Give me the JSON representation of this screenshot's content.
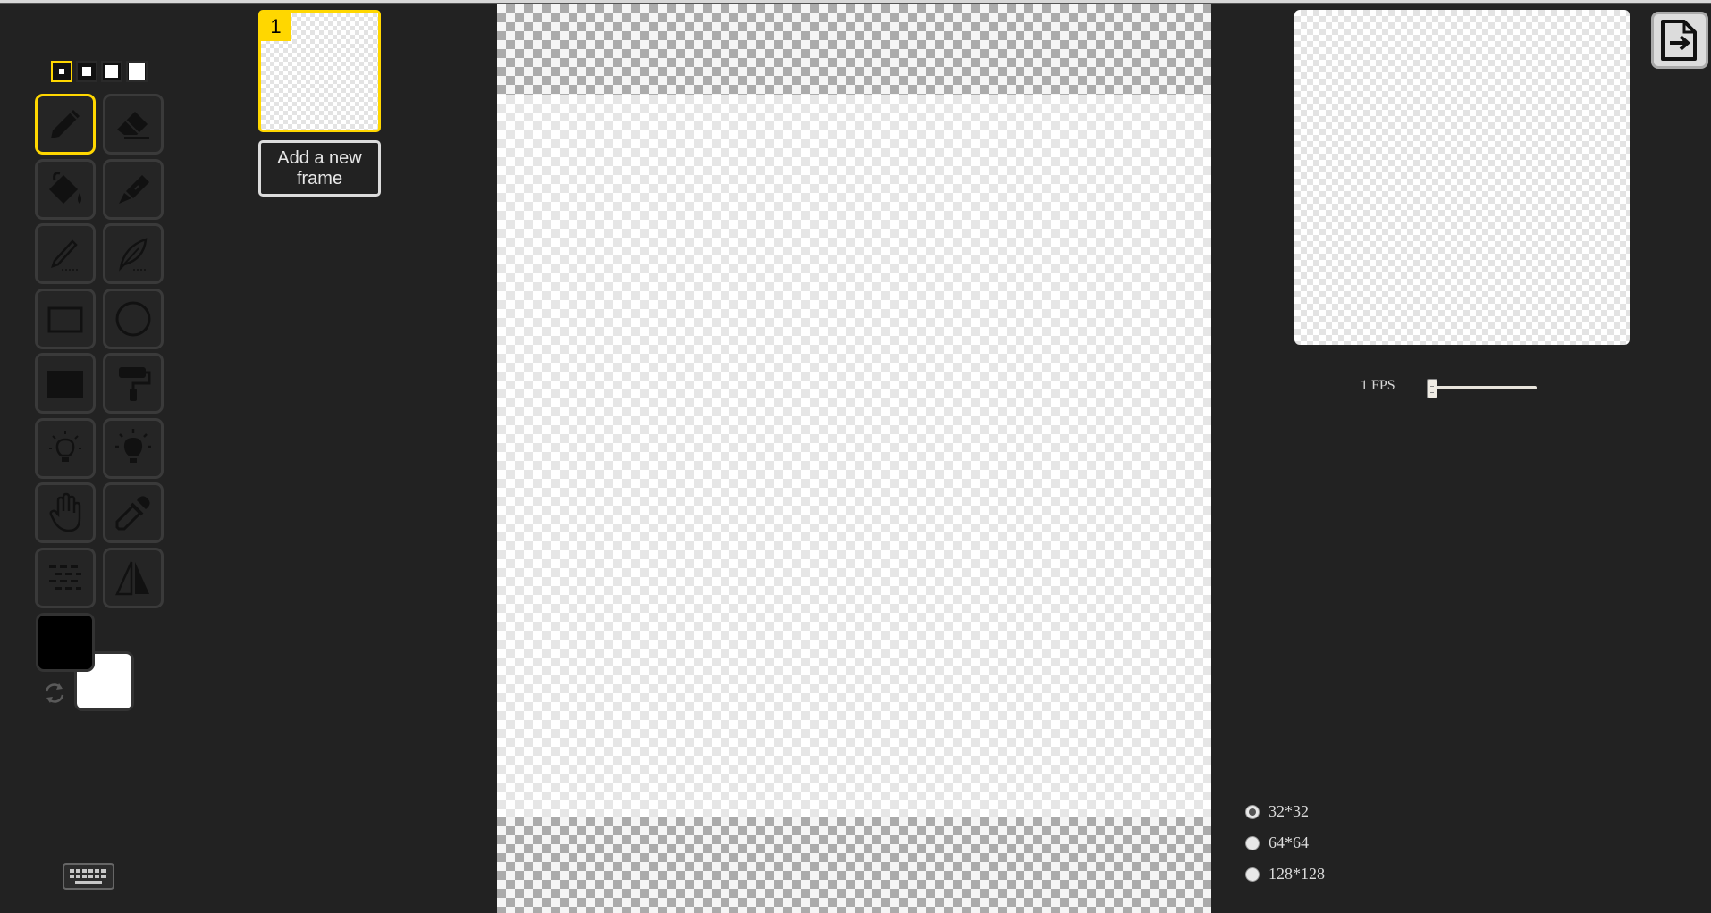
{
  "app": {
    "frames": [
      {
        "number": "1",
        "selected": true
      }
    ],
    "add_frame_label": "Add a new frame"
  },
  "toolbar": {
    "pen_sizes": [
      "pen-size-1",
      "pen-size-2",
      "pen-size-3",
      "pen-size-4"
    ],
    "selected_pen_size": 0,
    "tools": [
      {
        "id": "pen",
        "icon": "pencil-icon",
        "selected": true
      },
      {
        "id": "eraser",
        "icon": "eraser-icon"
      },
      {
        "id": "bucket",
        "icon": "paint-bucket-icon"
      },
      {
        "id": "paint-all",
        "icon": "magic-brush-icon"
      },
      {
        "id": "stroke",
        "icon": "stroke-pencil-icon"
      },
      {
        "id": "vertical-mirror",
        "icon": "feather-icon"
      },
      {
        "id": "rectangle",
        "icon": "rectangle-outline-icon"
      },
      {
        "id": "circle",
        "icon": "circle-outline-icon"
      },
      {
        "id": "filled-rectangle",
        "icon": "filled-rectangle-icon"
      },
      {
        "id": "paint-roller",
        "icon": "paint-roller-icon"
      },
      {
        "id": "lighten",
        "icon": "bulb-outline-icon"
      },
      {
        "id": "darken",
        "icon": "bulb-filled-icon"
      },
      {
        "id": "move",
        "icon": "hand-icon"
      },
      {
        "id": "color-picker",
        "icon": "eyedropper-icon"
      },
      {
        "id": "dithering",
        "icon": "dithering-icon"
      },
      {
        "id": "mirror",
        "icon": "mirror-icon"
      }
    ],
    "primary_color": "#000000",
    "secondary_color": "#ffffff"
  },
  "preview": {
    "fps_label": "1 FPS",
    "fps_value": 1,
    "fps_min": 1,
    "fps_max": 24
  },
  "resize": {
    "options": [
      {
        "label": "32*32",
        "checked": true
      },
      {
        "label": "64*64",
        "checked": false
      },
      {
        "label": "128*128",
        "checked": false
      }
    ]
  },
  "colors": {
    "accent": "#ffd700",
    "background": "#222222"
  }
}
